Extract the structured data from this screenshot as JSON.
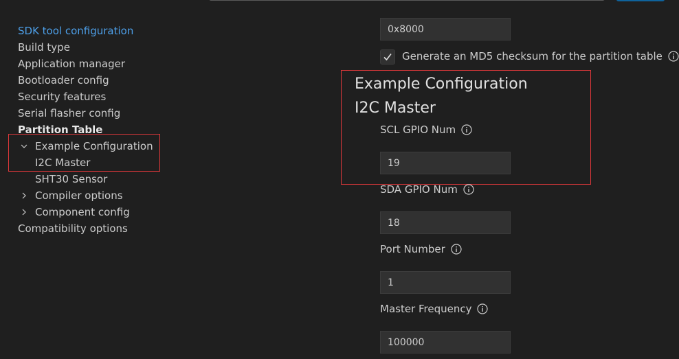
{
  "nav": {
    "items": [
      {
        "label": "SDK tool configuration"
      },
      {
        "label": "Build type"
      },
      {
        "label": "Application manager"
      },
      {
        "label": "Bootloader config"
      },
      {
        "label": "Security features"
      },
      {
        "label": "Serial flasher config"
      },
      {
        "label": "Partition Table"
      },
      {
        "label": "Example Configuration"
      },
      {
        "label": "I2C Master"
      },
      {
        "label": "SHT30 Sensor"
      },
      {
        "label": "Compiler options"
      },
      {
        "label": "Component config"
      },
      {
        "label": "Compatibility options"
      }
    ]
  },
  "main": {
    "partition_offset_value": "0x8000",
    "md5_checkbox": {
      "label": "Generate an MD5 checksum for the partition table",
      "checked": true
    },
    "section_title": "Example Configuration",
    "subsection_title": "I2C Master",
    "fields": [
      {
        "label": "SCL GPIO Num",
        "value": "19"
      },
      {
        "label": "SDA GPIO Num",
        "value": "18"
      },
      {
        "label": "Port Number",
        "value": "1"
      },
      {
        "label": "Master Frequency",
        "value": "100000"
      }
    ]
  },
  "colors": {
    "background": "#1f1f1f",
    "link_active": "#4d9fe8",
    "highlight_box": "#e0383b",
    "input_bg": "#313131"
  }
}
